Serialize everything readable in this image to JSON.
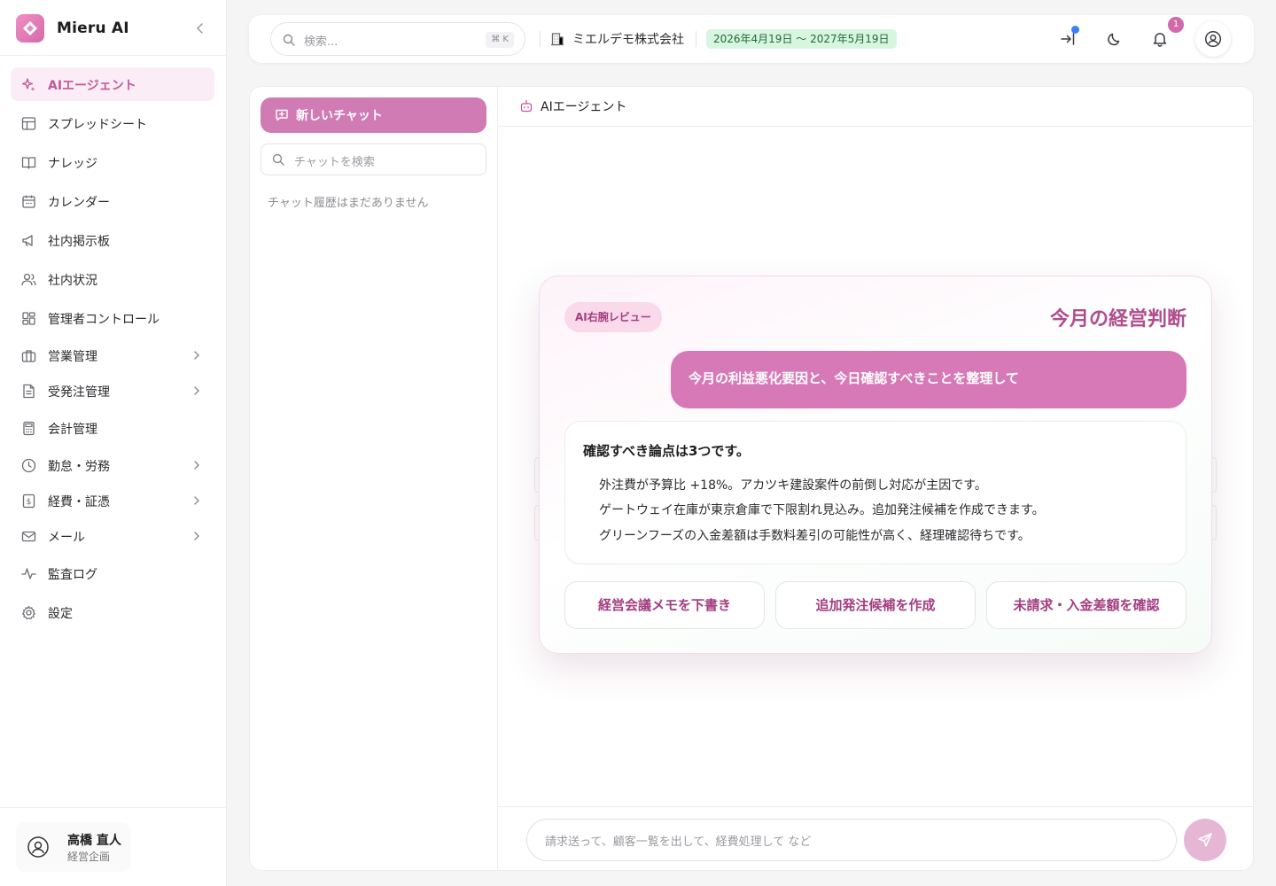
{
  "brand": {
    "name": "Mieru AI"
  },
  "sidebar": {
    "items": [
      {
        "label": "AIエージェント",
        "icon": "sparkles-icon",
        "active": true
      },
      {
        "label": "スプレッドシート",
        "icon": "table-icon"
      },
      {
        "label": "ナレッジ",
        "icon": "book-icon"
      },
      {
        "label": "カレンダー",
        "icon": "calendar-icon"
      },
      {
        "label": "社内掲示板",
        "icon": "megaphone-icon"
      },
      {
        "label": "社内状況",
        "icon": "users-icon"
      },
      {
        "label": "管理者コントロール",
        "icon": "dashboard-icon"
      },
      {
        "label": "営業管理",
        "icon": "briefcase-icon",
        "expandable": true
      },
      {
        "label": "受発注管理",
        "icon": "document-icon",
        "expandable": true
      },
      {
        "label": "会計管理",
        "icon": "calculator-icon"
      },
      {
        "label": "勤怠・労務",
        "icon": "clock-icon",
        "expandable": true
      },
      {
        "label": "経費・証憑",
        "icon": "receipt-icon",
        "expandable": true
      },
      {
        "label": "メール",
        "icon": "mail-icon",
        "expandable": true
      },
      {
        "label": "監査ログ",
        "icon": "activity-icon"
      },
      {
        "label": "設定",
        "icon": "gear-icon"
      }
    ]
  },
  "user": {
    "name": "高橋 直人",
    "role": "経営企画"
  },
  "topbar": {
    "search_placeholder": "検索...",
    "shortcut": "⌘ K",
    "company": "ミエルデモ株式会社",
    "period": "2026年4月19日 〜 2027年5月19日",
    "notification_count": "1"
  },
  "chat": {
    "new_chat_label": "新しいチャット",
    "search_placeholder": "チャットを検索",
    "empty_history": "チャット履歴はまだありません",
    "header_title": "AIエージェント",
    "input_placeholder": "請求送って、顧客一覧を出して、経費処理して など"
  },
  "review_card": {
    "pill": "AI右腕レビュー",
    "title": "今月の経営判断",
    "prompt": "今月の利益悪化要因と、今日確認すべきことを整理して",
    "answer_heading": "確認すべき論点は3つです。",
    "answer_lines": [
      "外注費が予算比 +18%。アカツキ建設案件の前倒し対応が主因です。",
      "ゲートウェイ在庫が東京倉庫で下限割れ見込み。追加発注候補を作成できます。",
      "グリーンフーズの入金差額は手数料差引の可能性が高く、経理確認待ちです。"
    ],
    "actions": [
      "経営会議メモを下書き",
      "追加発注候補を作成",
      "未請求・入金差額を確認"
    ]
  },
  "colors": {
    "accent": "#d17bb4",
    "accent_dark": "#b04d8e",
    "period_bg": "#d8f5df",
    "period_text": "#1f6b36",
    "notification_dot": "#3b82f6"
  }
}
